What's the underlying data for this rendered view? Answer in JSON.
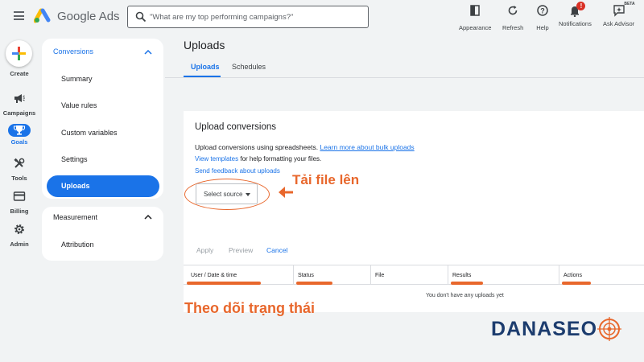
{
  "header": {
    "brand": "Google Ads",
    "search_placeholder": "\"What are my top performing campaigns?\"",
    "tools": [
      {
        "label": "Appearance",
        "icon": "appearance-icon"
      },
      {
        "label": "Refresh",
        "icon": "refresh-icon"
      },
      {
        "label": "Help",
        "icon": "help-icon"
      },
      {
        "label": "Notifications",
        "icon": "notifications-icon",
        "badge": "!"
      },
      {
        "label": "Ask Advisor",
        "icon": "ask-advisor-icon",
        "badge": "BETA"
      }
    ]
  },
  "rail": {
    "items": [
      {
        "label": "Create",
        "icon": "plus-icon"
      },
      {
        "label": "Campaigns",
        "icon": "megaphone-icon"
      },
      {
        "label": "Goals",
        "icon": "trophy-icon",
        "active": true
      },
      {
        "label": "Tools",
        "icon": "tools-icon"
      },
      {
        "label": "Billing",
        "icon": "card-icon"
      },
      {
        "label": "Admin",
        "icon": "gear-icon"
      }
    ]
  },
  "subnav": {
    "section1": "Conversions",
    "items": [
      "Summary",
      "Value rules",
      "Custom variables",
      "Settings",
      "Uploads"
    ],
    "active_item": "Uploads",
    "section2": "Measurement",
    "section2_items": [
      "Attribution"
    ]
  },
  "main": {
    "title": "Uploads",
    "tabs": [
      "Uploads",
      "Schedules"
    ],
    "active_tab": "Uploads",
    "card": {
      "title": "Upload conversions",
      "desc_prefix": "Upload conversions using spreadsheets.",
      "desc_link": "Learn more about bulk uploads",
      "templates_link": "View templates",
      "templates_suffix": "for help formatting your files.",
      "feedback_link": "Send feedback about uploads",
      "select_source": "Select source",
      "actions": {
        "apply": "Apply",
        "preview": "Preview",
        "cancel": "Cancel"
      }
    },
    "table": {
      "columns": [
        "User / Date & time",
        "Status",
        "File",
        "Results",
        "Actions"
      ],
      "empty_message": "You don't have any uploads yet"
    }
  },
  "annotations": {
    "upload_note": "Tải file lên",
    "track_note": "Theo dõi trạng thái",
    "accent_color": "#e8672c"
  },
  "watermark": "DANASEO"
}
